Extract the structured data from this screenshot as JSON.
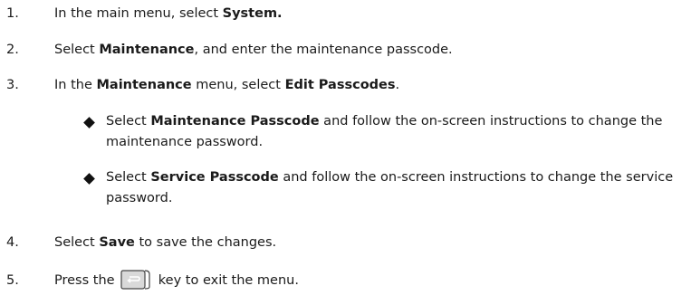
{
  "steps": [
    {
      "num": "1.",
      "pre": "In the main menu, select ",
      "bold": "System.",
      "post": ""
    },
    {
      "num": "2.",
      "pre": "Select ",
      "bold": "Maintenance",
      "post": ", and enter the maintenance passcode."
    },
    {
      "num": "3.",
      "pre": "In the ",
      "bold": "Maintenance",
      "mid": " menu, select ",
      "bold2": "Edit Passcodes",
      "post": "."
    },
    {
      "num": "4.",
      "pre": "Select ",
      "bold": "Save",
      "post": " to save the changes."
    },
    {
      "num": "5.",
      "pre": "Press the ",
      "post": " key to exit the menu.",
      "icon": "back-key-icon"
    }
  ],
  "bullets": [
    {
      "pre": "Select ",
      "bold": "Maintenance Passcode",
      "post": " and follow the on-screen instructions to change the maintenance password."
    },
    {
      "pre": "Select ",
      "bold": "Service Passcode",
      "post": " and follow the on-screen instructions to change the service password."
    }
  ]
}
